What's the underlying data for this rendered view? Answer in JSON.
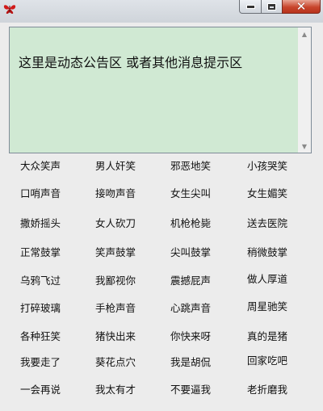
{
  "window": {
    "notice_text": "这里是动态公告区 或者其他消息提示区",
    "close_glyph": "✕"
  },
  "buttons": [
    [
      "大众笑声",
      "男人奸笑",
      "邪恶地笑",
      "小孩哭笑"
    ],
    [
      "口哨声音",
      "接吻声音",
      "女生尖叫",
      "女生媚笑"
    ],
    [
      "撒娇摇头",
      "女人砍刀",
      "机枪枪毙",
      "送去医院"
    ],
    [
      "正常鼓掌",
      "笑声鼓掌",
      "尖叫鼓掌",
      "稍微鼓掌"
    ],
    [
      "乌鸦飞过",
      "我鄙视你",
      "震撼屁声",
      "做人厚道"
    ],
    [
      "打碎玻璃",
      "手枪声音",
      "心跳声音",
      "周星驰笑"
    ],
    [
      "各种狂笑",
      "猪快出来",
      "你快来呀",
      "真的是猪"
    ],
    [
      "我要走了",
      "葵花点穴",
      "我是胡侃",
      "回家吃吧"
    ],
    [
      "一会再说",
      "我太有才",
      "不要逼我",
      "老折磨我"
    ]
  ]
}
